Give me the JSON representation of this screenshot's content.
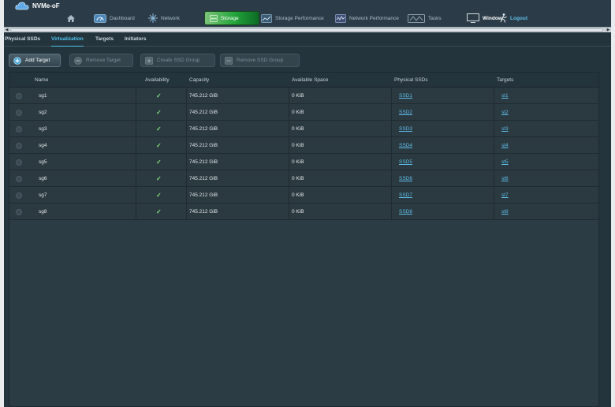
{
  "app": {
    "title": "NVMe-oF"
  },
  "nav": [
    {
      "label": "",
      "icon": "home-icon"
    },
    {
      "label": "Dashboard",
      "icon": "dashboard-icon"
    },
    {
      "label": "Network",
      "icon": "network-icon"
    },
    {
      "label": "Storage",
      "icon": "storage-icon",
      "active": true
    },
    {
      "label": "Storage Performance",
      "icon": "storage-performance-icon"
    },
    {
      "label": "Network Performance",
      "icon": "network-performance-icon"
    },
    {
      "label": "Tasks",
      "icon": "tasks-icon"
    },
    {
      "label": "Window",
      "icon": "window-icon"
    },
    {
      "label": "Logout",
      "icon": "logout-icon"
    }
  ],
  "subtabs": [
    {
      "label": "Physical SSDs"
    },
    {
      "label": "Virtualization",
      "active": true
    },
    {
      "label": "Targets"
    },
    {
      "label": "Initiators"
    }
  ],
  "toolbar": {
    "add_target": "Add Target",
    "remove_target": "Remove Target",
    "create_ssd_group": "Create SSD Group",
    "remove_ssd_group": "Remove SSD Group"
  },
  "table": {
    "headers": {
      "name": "Name",
      "availability": "Availability",
      "capacity": "Capacity",
      "available_space": "Available Space",
      "physical_ssds": "Physical SSDs",
      "targets": "Targets"
    },
    "rows": [
      {
        "name": "sg1",
        "availability": "✓",
        "capacity": "745.212 GiB",
        "available_space": "0 KiB",
        "physical_ssds": "SSD1",
        "targets": "st1"
      },
      {
        "name": "sg2",
        "availability": "✓",
        "capacity": "745.212 GiB",
        "available_space": "0 KiB",
        "physical_ssds": "SSD2",
        "targets": "st2"
      },
      {
        "name": "sg3",
        "availability": "✓",
        "capacity": "745.212 GiB",
        "available_space": "0 KiB",
        "physical_ssds": "SSD3",
        "targets": "st3"
      },
      {
        "name": "sg4",
        "availability": "✓",
        "capacity": "745.212 GiB",
        "available_space": "0 KiB",
        "physical_ssds": "SSD4",
        "targets": "st4"
      },
      {
        "name": "sg5",
        "availability": "✓",
        "capacity": "745.212 GiB",
        "available_space": "0 KiB",
        "physical_ssds": "SSD5",
        "targets": "st5"
      },
      {
        "name": "sg6",
        "availability": "✓",
        "capacity": "745.212 GiB",
        "available_space": "0 KiB",
        "physical_ssds": "SSD6",
        "targets": "st6"
      },
      {
        "name": "sg7",
        "availability": "✓",
        "capacity": "745.212 GiB",
        "available_space": "0 KiB",
        "physical_ssds": "SSD7",
        "targets": "st7"
      },
      {
        "name": "sg8",
        "availability": "✓",
        "capacity": "745.212 GiB",
        "available_space": "0 KiB",
        "physical_ssds": "SSD8",
        "targets": "st8"
      }
    ]
  },
  "colors": {
    "accent": "#4ec3f0",
    "active_nav": "#23a43a",
    "background": "#24343c",
    "check": "#7ee07a"
  }
}
